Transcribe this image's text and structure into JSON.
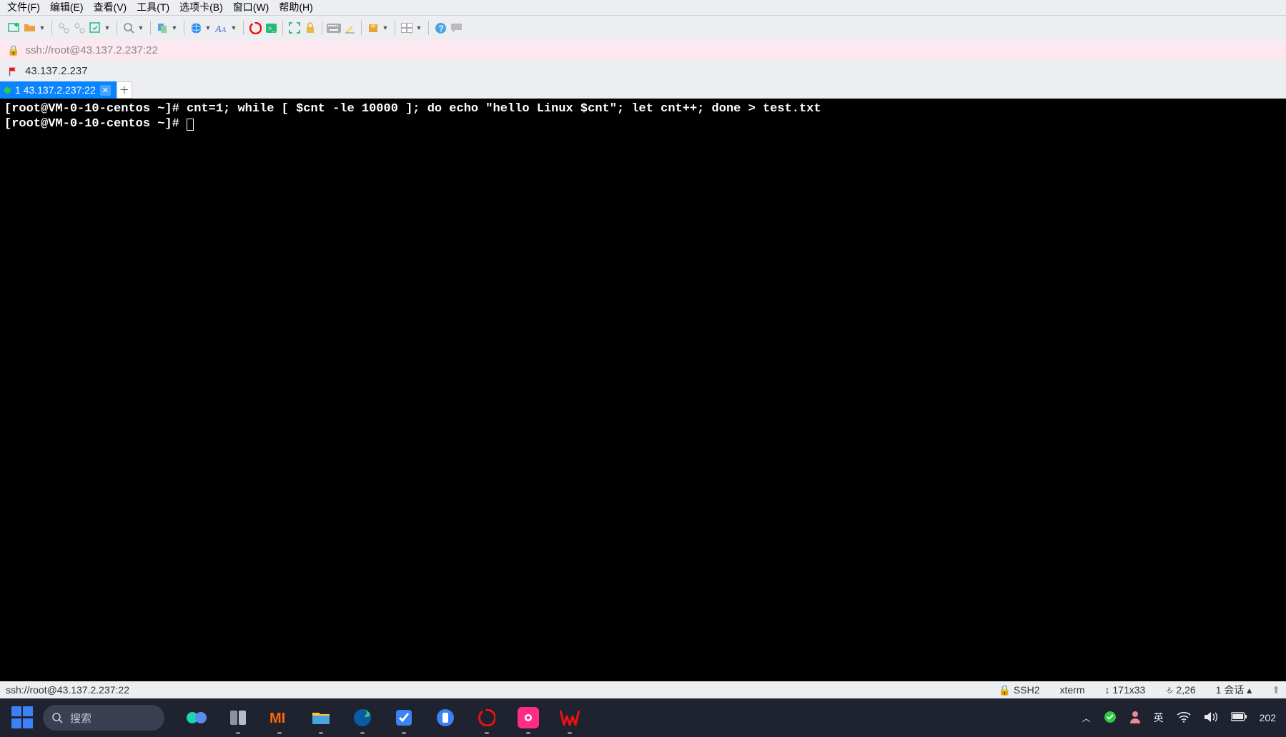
{
  "menu": {
    "file": "文件(F)",
    "edit": "编辑(E)",
    "view": "查看(V)",
    "tools": "工具(T)",
    "tabs": "选项卡(B)",
    "window": "窗口(W)",
    "help": "帮助(H)"
  },
  "address": {
    "url": "ssh://root@43.137.2.237:22"
  },
  "connection": {
    "host": "43.137.2.237"
  },
  "tab": {
    "label": "1 43.137.2.237:22"
  },
  "terminal": {
    "line1": "[root@VM-0-10-centos ~]# cnt=1; while [ $cnt -le 10000 ]; do echo \"hello Linux $cnt\"; let cnt++; done > test.txt",
    "line2": "[root@VM-0-10-centos ~]# "
  },
  "status": {
    "left": "ssh://root@43.137.2.237:22",
    "proto": "SSH2",
    "term": "xterm",
    "size": "171x33",
    "pos": "2,26",
    "sess": "1 会话"
  },
  "taskbar": {
    "search_placeholder": "搜索",
    "ime": "英",
    "clock": "202"
  }
}
